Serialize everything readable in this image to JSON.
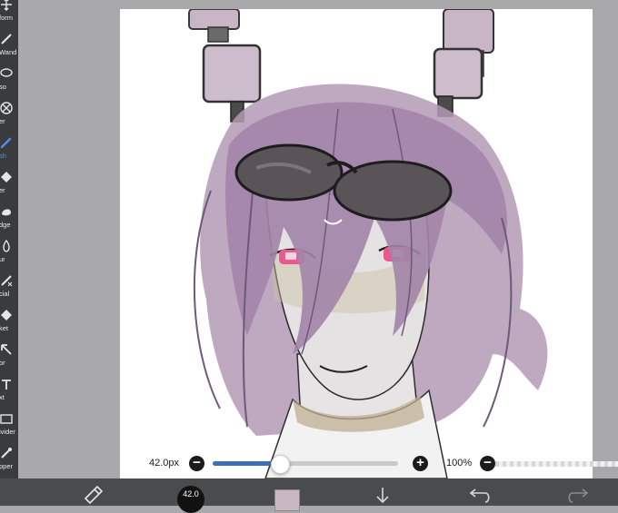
{
  "toolbar": {
    "items": [
      {
        "label": "form",
        "icon": "transform-icon"
      },
      {
        "label": "Wand",
        "icon": "magic-wand-icon"
      },
      {
        "label": "so",
        "icon": "lasso-icon"
      },
      {
        "label": "er",
        "icon": "filter-icon"
      },
      {
        "label": "sh",
        "icon": "brush-icon",
        "active": true
      },
      {
        "label": "er",
        "icon": "eraser-icon"
      },
      {
        "label": "dge",
        "icon": "smudge-icon"
      },
      {
        "label": "ur",
        "icon": "blur-icon"
      },
      {
        "label": "cial",
        "icon": "special-icon"
      },
      {
        "label": "ket",
        "icon": "bucket-icon"
      },
      {
        "label": "or",
        "icon": "selector-icon"
      },
      {
        "label": "xt",
        "icon": "text-icon"
      },
      {
        "label": "ivider",
        "icon": "frame-divider-icon"
      },
      {
        "label": "pper",
        "icon": "eyedropper-icon"
      }
    ]
  },
  "brush": {
    "size_label": "42.0px",
    "size_fraction": 0.36,
    "opacity_label": "100%",
    "minus": "−",
    "plus": "+"
  },
  "bottombar": {
    "brush_size_display": "42.0",
    "current_color": "#c9b8c4"
  },
  "colors": {
    "toolbar_bg": "#3a3b3d",
    "active_tool": "#4f8ff3",
    "slider_fill": "#3f6fb6",
    "hair": "#9a7fa3",
    "hair_dark": "#7d6589",
    "skin": "#e4e1e2",
    "eyes": "#e0457e"
  }
}
